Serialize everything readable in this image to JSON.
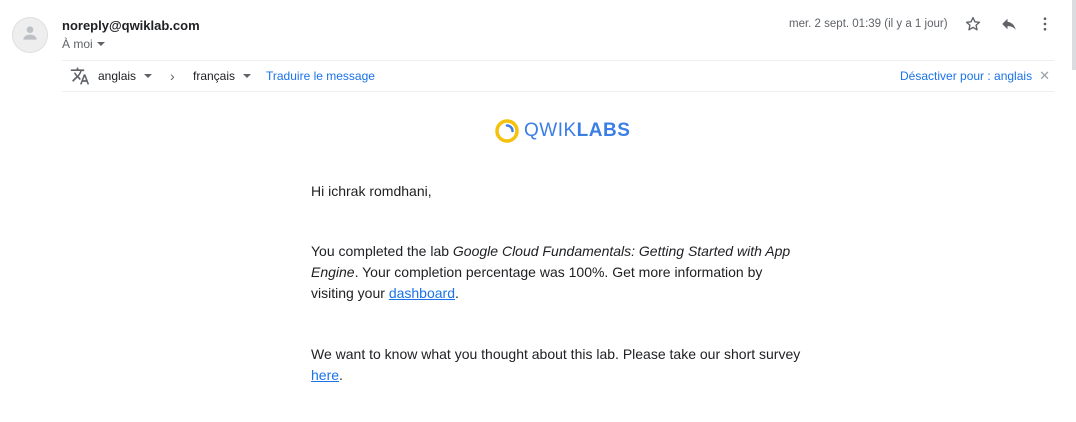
{
  "header": {
    "sender": "noreply@qwiklab.com",
    "to_label": "À moi",
    "date": "mer. 2 sept. 01:39 (il y a 1 jour)"
  },
  "translate": {
    "source_lang": "anglais",
    "target_lang": "français",
    "translate_link": "Traduire le message",
    "disable_link": "Désactiver pour : anglais"
  },
  "logo": {
    "brand_light": "QWIK",
    "brand_bold": "LABS",
    "colors": {
      "ring": "#f4c20d",
      "text": "#3a7ee6"
    }
  },
  "email": {
    "greeting": "Hi ichrak romdhani,",
    "p1_prefix": "You completed the lab ",
    "p1_lab_name": "Google Cloud Fundamentals: Getting Started with App Engine",
    "p1_middle": ". Your completion percentage was 100%. Get more information by visiting your ",
    "p1_link": "dashboard",
    "p1_suffix": ".",
    "p2_prefix": "We want to know what you thought about this lab. Please take our short survey ",
    "p2_link": "here",
    "p2_suffix": "."
  },
  "icons": {
    "avatar": "person-icon",
    "star": "star-icon",
    "reply": "reply-icon",
    "more": "more-vert-icon",
    "translate": "translate-icon"
  }
}
